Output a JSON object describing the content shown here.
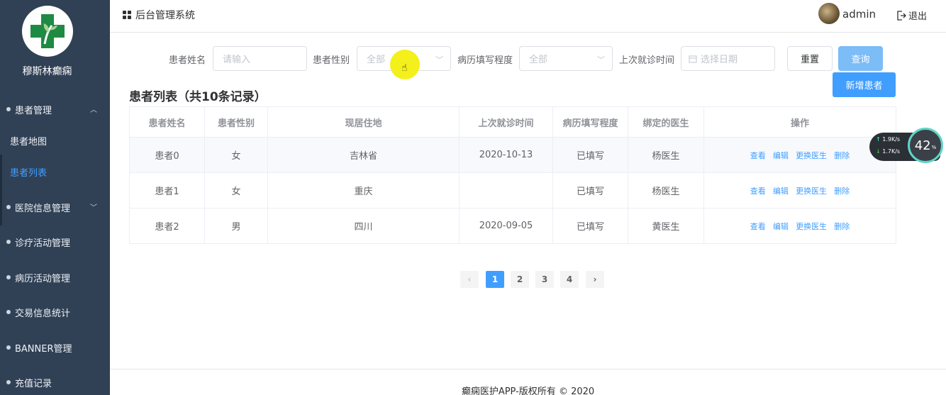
{
  "sidebar": {
    "brand": "穆斯林癫痫",
    "items": [
      {
        "label": "患者管理",
        "expanded": true
      },
      {
        "label": "医院信息管理"
      },
      {
        "label": "诊疗活动管理"
      },
      {
        "label": "病历活动管理"
      },
      {
        "label": "交易信息统计"
      },
      {
        "label": "BANNER管理"
      },
      {
        "label": "充值记录"
      }
    ],
    "sub_items": [
      {
        "label": "患者地图"
      },
      {
        "label": "患者列表",
        "active": true
      }
    ]
  },
  "header": {
    "title": "后台管理系统",
    "user": "admin",
    "logout": "退出"
  },
  "filters": {
    "name_label": "患者姓名",
    "name_placeholder": "请输入",
    "gender_label": "患者性别",
    "gender_value": "全部",
    "record_label": "病历填写程度",
    "record_value": "全部",
    "last_visit_label": "上次就诊时间",
    "last_visit_placeholder": "选择日期",
    "reset": "重置",
    "search": "查询",
    "add": "新增患者"
  },
  "list_title": "患者列表（共10条记录）",
  "table": {
    "columns": [
      "患者姓名",
      "患者性别",
      "现居住地",
      "上次就诊时间",
      "病历填写程度",
      "绑定的医生",
      "操作"
    ],
    "rows": [
      {
        "name": "患者0",
        "gender": "女",
        "address": "吉林省",
        "last_visit": "2020-10-13",
        "record": "已填写",
        "doctor": "杨医生"
      },
      {
        "name": "患者1",
        "gender": "女",
        "address": "重庆",
        "last_visit": "",
        "record": "已填写",
        "doctor": "杨医生"
      },
      {
        "name": "患者2",
        "gender": "男",
        "address": "四川",
        "last_visit": "2020-09-05",
        "record": "已填写",
        "doctor": "黄医生"
      }
    ],
    "actions": [
      "查看",
      "编辑",
      "更换医生",
      "删除"
    ]
  },
  "pagination": {
    "pages": [
      "1",
      "2",
      "3",
      "4"
    ],
    "current": "1",
    "prev": "‹",
    "next": "›"
  },
  "footer": "癫痫医护APP-版权所有 © 2020",
  "speed_widget": {
    "up": "1.9",
    "down": "1.7",
    "unit": "K/s",
    "percent": "42",
    "percent_unit": "%"
  },
  "colors": {
    "sidebar_bg": "#304156",
    "primary": "#409eff",
    "active_sub": "#409eff"
  }
}
